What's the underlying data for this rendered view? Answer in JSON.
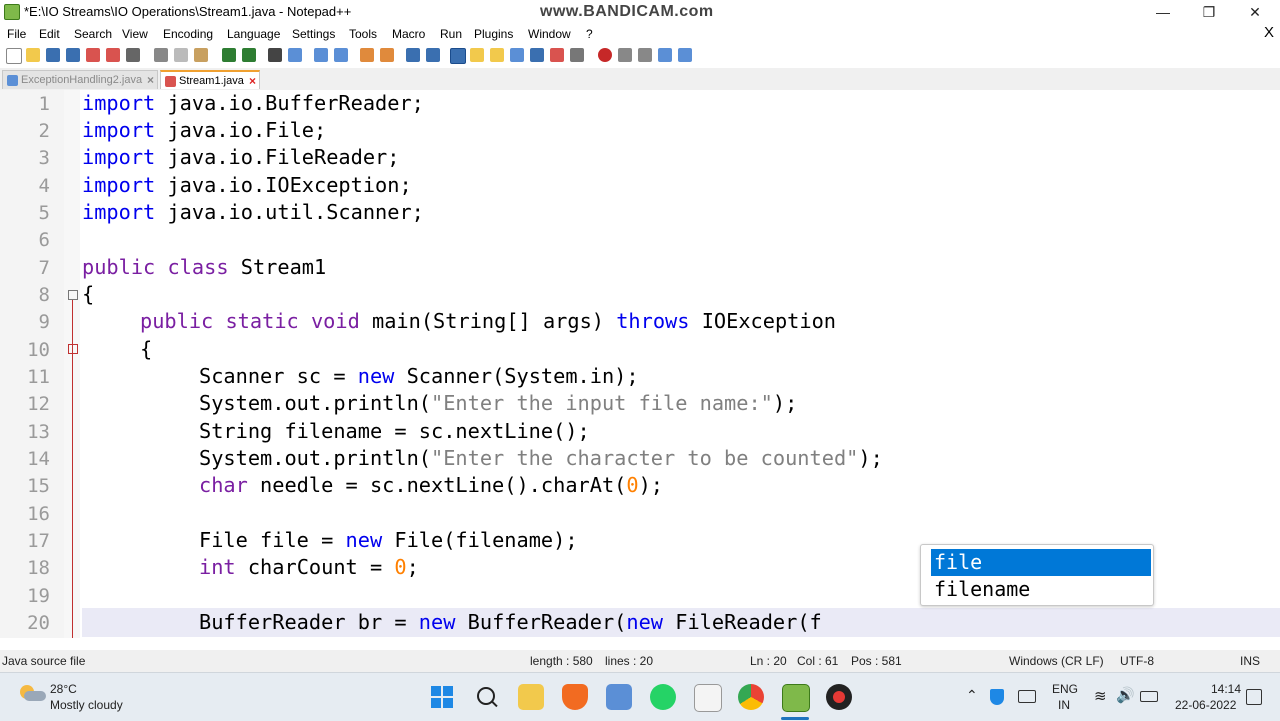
{
  "window": {
    "title": "*E:\\IO Streams\\IO Operations\\Stream1.java - Notepad++",
    "watermark": "www.BANDICAM.com",
    "min_icon": "minimize-icon",
    "max_icon": "restore-icon",
    "close_icon": "close-icon"
  },
  "menu": {
    "items": [
      "File",
      "Edit",
      "Search",
      "View",
      "Encoding",
      "Language",
      "Settings",
      "Tools",
      "Macro",
      "Run",
      "Plugins",
      "Window",
      "?"
    ],
    "doc_close": "X"
  },
  "tabs": [
    {
      "label": "ExceptionHandling2.java",
      "active": false
    },
    {
      "label": "Stream1.java",
      "active": true
    }
  ],
  "editor": {
    "lines": [
      "1",
      "2",
      "3",
      "4",
      "5",
      "6",
      "7",
      "8",
      "9",
      "10",
      "11",
      "12",
      "13",
      "14",
      "15",
      "16",
      "17",
      "18",
      "19",
      "20"
    ],
    "code": {
      "l1_kw": "import",
      "l1_rest": " java.io.BufferReader;",
      "l2_kw": "import",
      "l2_rest": " java.io.File;",
      "l3_kw": "import",
      "l3_rest": " java.io.FileReader;",
      "l4_kw": "import",
      "l4_rest": " java.io.IOException;",
      "l5_kw": "import",
      "l5_rest": " java.io.util.Scanner;",
      "l7_kw": "public class",
      "l7_rest": " Stream1",
      "l8": "{",
      "l9_kw": "public static void",
      "l9_mid": " main(String[] args) ",
      "l9_kw2": "throws",
      "l9_rest": " IOException",
      "l10": "{",
      "l11_a": "Scanner sc = ",
      "l11_kw": "new",
      "l11_b": " Scanner(System.in);",
      "l12_a": "System.out.println(",
      "l12_str": "\"Enter the input file name:\"",
      "l12_b": ");",
      "l13": "String filename = sc.nextLine();",
      "l14_a": "System.out.println(",
      "l14_str": "\"Enter the character to be counted\"",
      "l14_b": ");",
      "l15_kw": "char",
      "l15_a": " needle = sc.nextLine().charAt(",
      "l15_num": "0",
      "l15_b": ");",
      "l17_a": "File file = ",
      "l17_kw": "new",
      "l17_b": " File(filename);",
      "l18_kw": "int",
      "l18_a": " charCount = ",
      "l18_num": "0",
      "l18_b": ";",
      "l20_a": "BufferReader br = ",
      "l20_kw": "new",
      "l20_b": " BufferReader(",
      "l20_kw2": "new",
      "l20_c": " FileReader(f"
    }
  },
  "autocomplete": {
    "items": [
      "file",
      "filename"
    ],
    "selected": 0
  },
  "status": {
    "filetype": "Java source file",
    "length": "length : 580",
    "lines": "lines : 20",
    "ln": "Ln : 20",
    "col": "Col : 61",
    "pos": "Pos : 581",
    "eol": "Windows (CR LF)",
    "encoding": "UTF-8",
    "mode": "INS"
  },
  "taskbar": {
    "weather_temp": "28°C",
    "weather_desc": "Mostly cloudy",
    "lang_top": "ENG",
    "lang_bottom": "IN",
    "time": "14:14",
    "date": "22-06-2022"
  },
  "colors": {
    "keyword": "#7a1fa2",
    "keyword_blue": "#0000ee",
    "string": "#808080",
    "number": "#ff8000",
    "selection": "#0078d7"
  }
}
